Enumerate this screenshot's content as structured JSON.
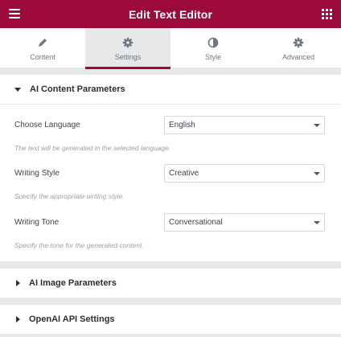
{
  "header": {
    "title": "Edit Text Editor",
    "menu_icon": "hamburger-icon",
    "grid_icon": "grid-icon"
  },
  "tabs": [
    {
      "label": "Content",
      "icon": "pencil-icon"
    },
    {
      "label": "Settings",
      "icon": "gear-icon",
      "active": true
    },
    {
      "label": "Style",
      "icon": "half-circle-icon"
    },
    {
      "label": "Advanced",
      "icon": "gear-icon"
    }
  ],
  "sections": {
    "content": {
      "title": "AI Content Parameters",
      "fields": [
        {
          "label": "Choose Language",
          "value": "English",
          "description": "The text will be generated in the selected language."
        },
        {
          "label": "Writing Style",
          "value": "Creative",
          "description": "Specify the appropriate writing style."
        },
        {
          "label": "Writing Tone",
          "value": "Conversational",
          "description": "Specify the tone for the generated content."
        }
      ]
    },
    "image": {
      "title": "AI Image Parameters"
    },
    "api": {
      "title": "OpenAI API Settings"
    }
  },
  "colors": {
    "brand": "#9b0a3b",
    "panel_bg": "#e6e8ea"
  }
}
